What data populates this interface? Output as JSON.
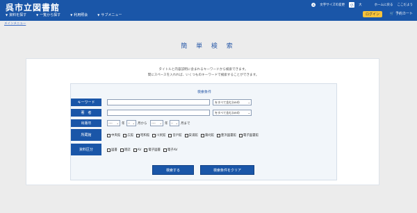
{
  "header": {
    "logo": "呉市立図書館",
    "nav": [
      {
        "label": "資料を探す"
      },
      {
        "label": "一覧から探す"
      },
      {
        "label": "利用照会"
      },
      {
        "label": "サブメニュー"
      }
    ],
    "font_size_label": "文字サイズの変更",
    "font_size_small": "小",
    "font_size_large": "大",
    "home_link": "ホームに戻る",
    "help_link": "ここだよう",
    "login_label": "ログイン",
    "cart_label": "予約カート"
  },
  "breadcrumb": "メインメニュー",
  "page_title": "簡 単 検 索",
  "intro": {
    "line1": "タイトルと内容説明に含まれるキーワードから検索できます。",
    "line2": "間にスペースを入れれば、いくつものキーワードで検索することができます。"
  },
  "conditions": {
    "title": "検索条件",
    "keyword": {
      "label": "キーワード",
      "value": "",
      "match": "をすべて含む(and)"
    },
    "author": {
      "label": "著　者",
      "value": "",
      "match": "をすべて含む(and)"
    },
    "year": {
      "label": "出版年",
      "from_year": "----",
      "from_month": "--",
      "to_year": "----",
      "to_month": "--",
      "year_unit": "年",
      "month_from_unit": "月から",
      "month_to_unit": "月まで"
    },
    "library": {
      "label": "所蔵館",
      "options": [
        "中央館",
        "広館",
        "昭和館",
        "川尻館",
        "音戸館",
        "安浦館",
        "蒲刈館",
        "豊浜図書館",
        "電子図書館"
      ]
    },
    "material": {
      "label": "資料区分",
      "options": [
        "図書",
        "雑誌",
        "AV",
        "電子図書",
        "電子AV"
      ]
    }
  },
  "buttons": {
    "search": "検索する",
    "clear": "検索条件をクリア"
  },
  "colors": {
    "header_bg": "#1a56a8",
    "accent": "#f7c33a",
    "page_bg": "#ececec"
  }
}
